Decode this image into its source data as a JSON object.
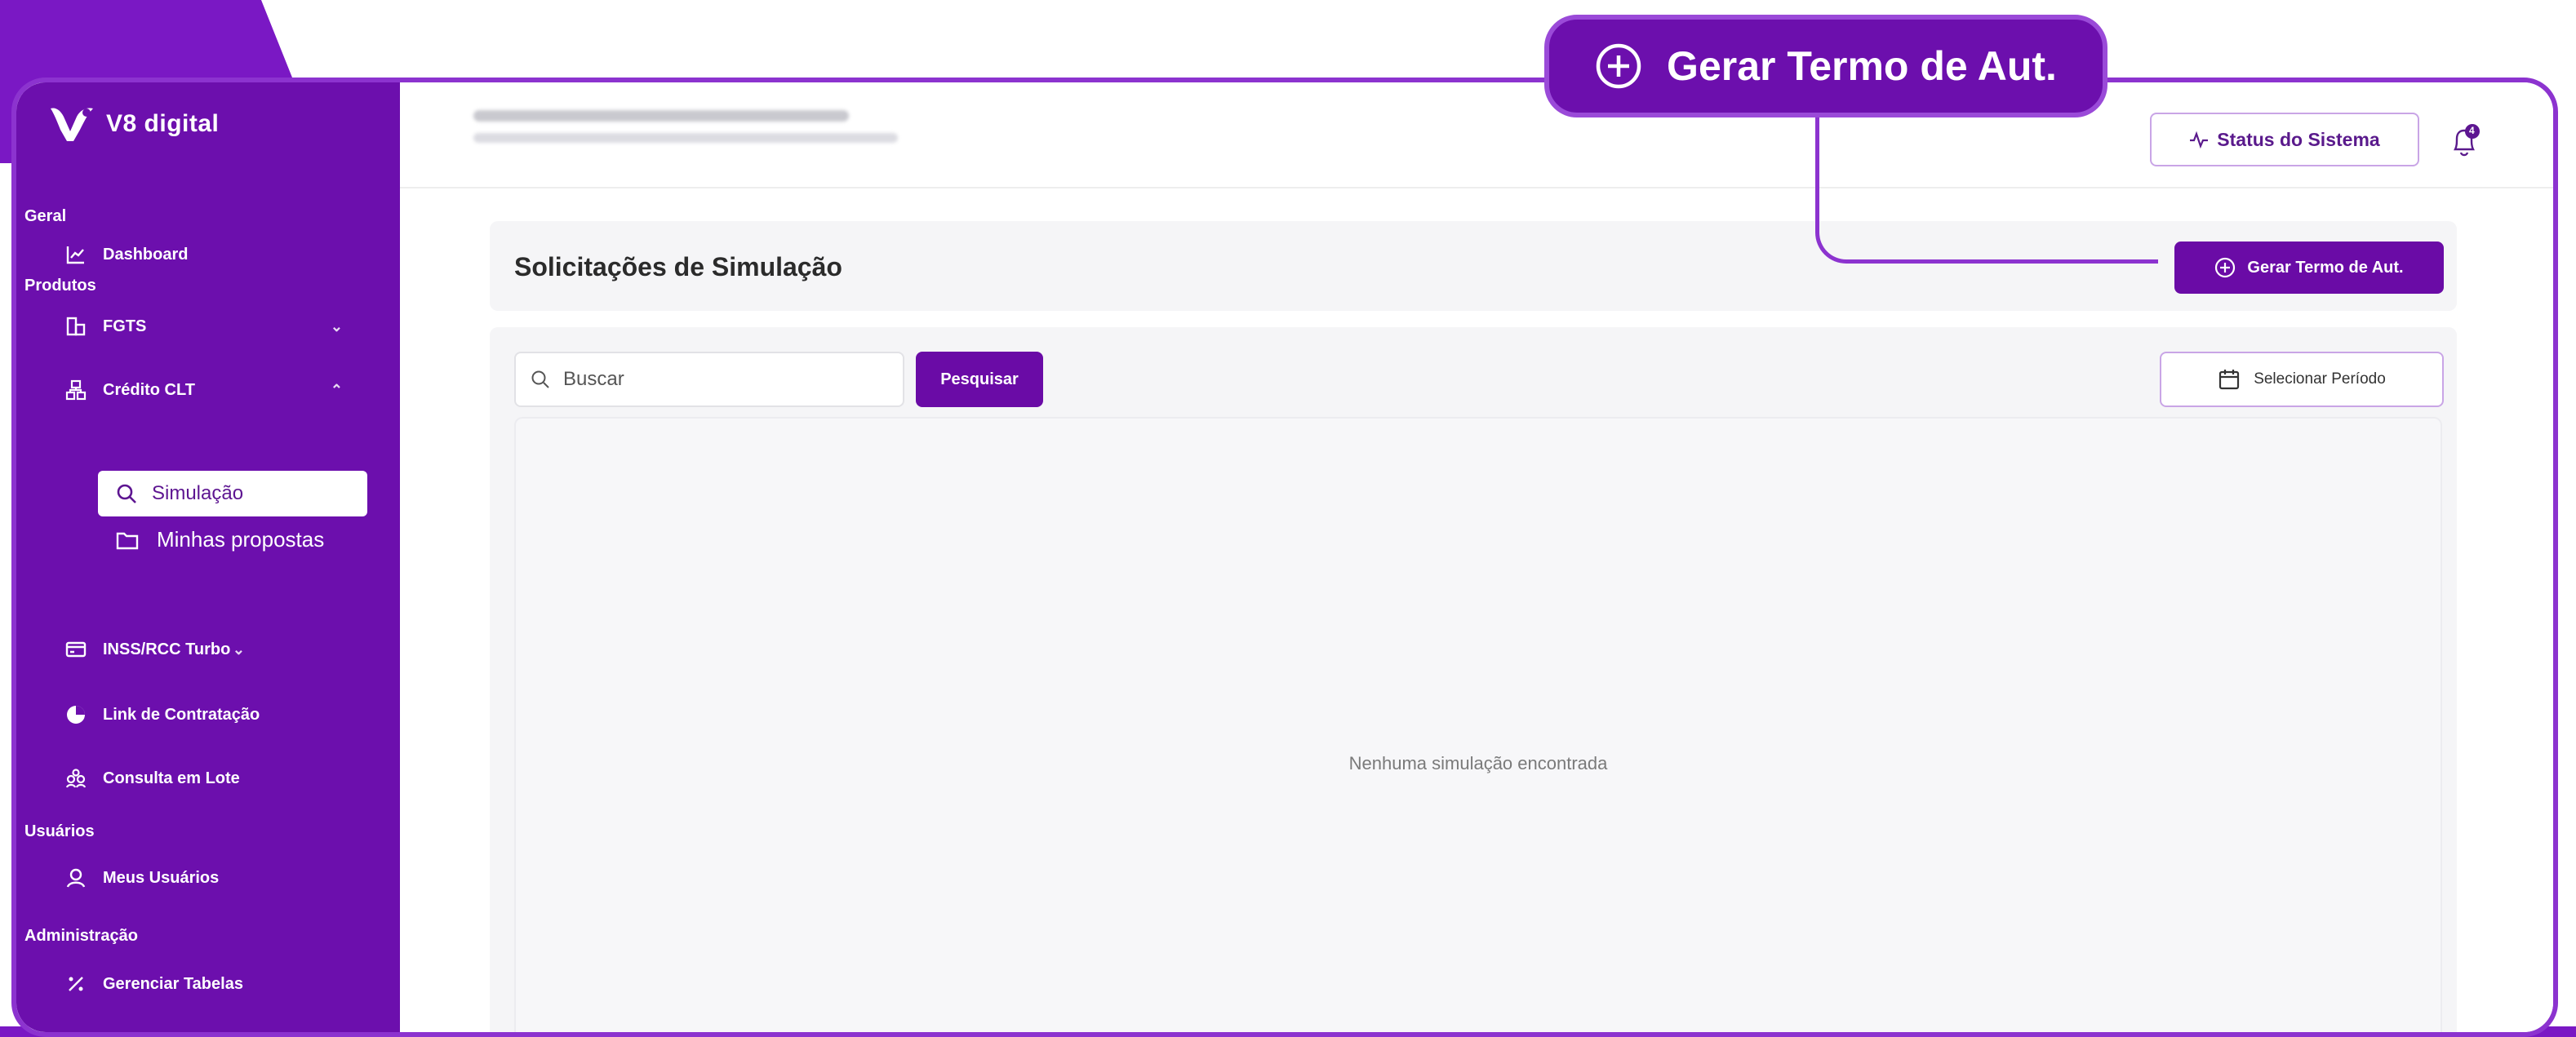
{
  "app": {
    "brand": "V8 digital",
    "brand_color": "#6c0fad",
    "accent": "#6a0ba6"
  },
  "callout": {
    "label": "Gerar Termo de Aut.",
    "icon": "plus-circle-icon"
  },
  "sidebar": {
    "sections": [
      {
        "label": "Geral"
      },
      {
        "label": "Produtos"
      },
      {
        "label": "Usuários"
      },
      {
        "label": "Administração"
      }
    ],
    "items": [
      {
        "label": "Dashboard",
        "icon": "chart-line-icon"
      },
      {
        "label": "FGTS",
        "icon": "building-icon"
      },
      {
        "label": "Crédito CLT",
        "icon": "network-icon"
      },
      {
        "label": "INSS/RCC Turbo",
        "icon": "card-icon"
      },
      {
        "label": "Link de Contratação",
        "icon": "pie-icon"
      },
      {
        "label": "Consulta em Lote",
        "icon": "people-group-icon"
      },
      {
        "label": "Meus Usuários",
        "icon": "user-icon"
      },
      {
        "label": "Gerenciar Tabelas",
        "icon": "percent-icon"
      }
    ],
    "sub_items": [
      {
        "label": "Simulação",
        "icon": "search-icon"
      },
      {
        "label": "Minhas propostas",
        "icon": "folder-icon"
      }
    ]
  },
  "header": {
    "status_label": "Status do Sistema",
    "notification_count": "4"
  },
  "main": {
    "title": "Solicitações de Simulação",
    "gerar_label": "Gerar Termo de Aut.",
    "search_placeholder": "Buscar",
    "search_button": "Pesquisar",
    "period_button": "Selecionar Período",
    "empty_message": "Nenhuma simulação encontrada"
  }
}
